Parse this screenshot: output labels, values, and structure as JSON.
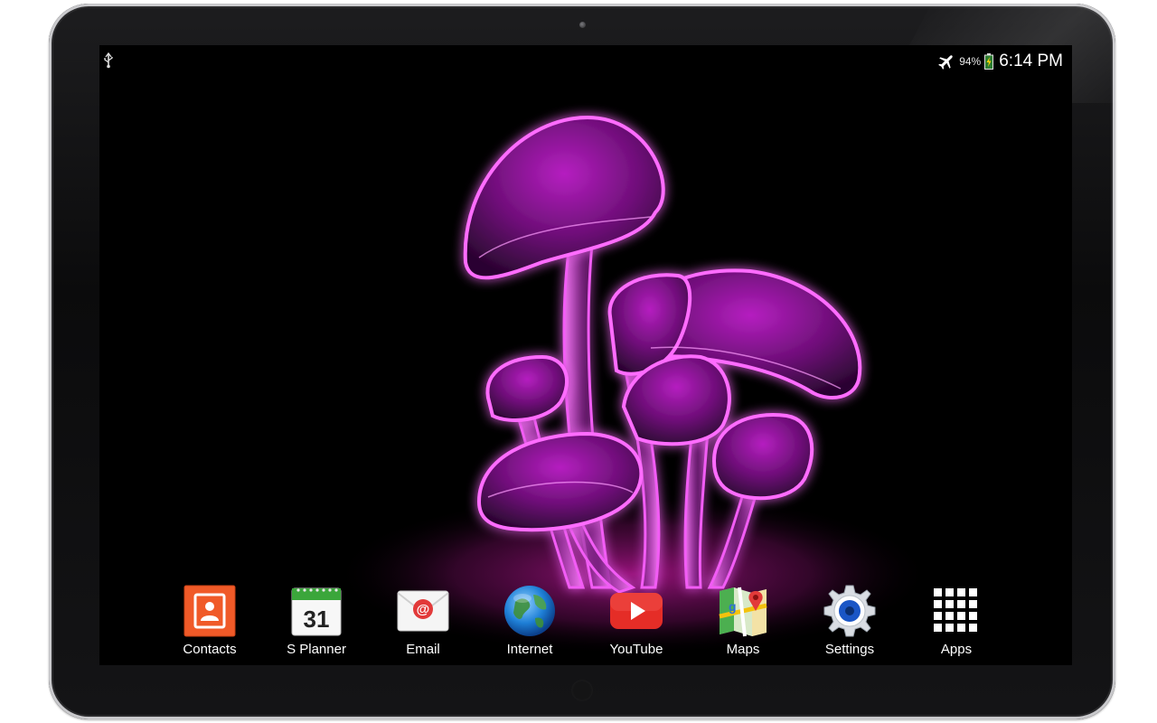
{
  "status_bar": {
    "left_icon": "usb-icon",
    "airplane_icon": "airplane-mode-icon",
    "battery_percent": "94%",
    "battery_icon": "battery-charging-icon",
    "time": "6:14 PM"
  },
  "dock": {
    "apps": [
      {
        "label": "Contacts",
        "icon": "contacts-icon",
        "color": "#f05a28"
      },
      {
        "label": "S Planner",
        "icon": "calendar-icon",
        "date": "31",
        "color": "#3ba63b"
      },
      {
        "label": "Email",
        "icon": "email-icon",
        "color": "#e23a3a"
      },
      {
        "label": "Internet",
        "icon": "globe-icon",
        "color": "#1e7fd6"
      },
      {
        "label": "YouTube",
        "icon": "youtube-icon",
        "color": "#e52d27"
      },
      {
        "label": "Maps",
        "icon": "maps-icon",
        "color": "#4caf50"
      },
      {
        "label": "Settings",
        "icon": "gear-icon",
        "color": "#1a56c6"
      },
      {
        "label": "Apps",
        "icon": "app-grid-icon",
        "color": "#ffffff"
      }
    ]
  },
  "wallpaper": {
    "subject": "glowing-mushrooms",
    "accent": "#e23be6"
  }
}
